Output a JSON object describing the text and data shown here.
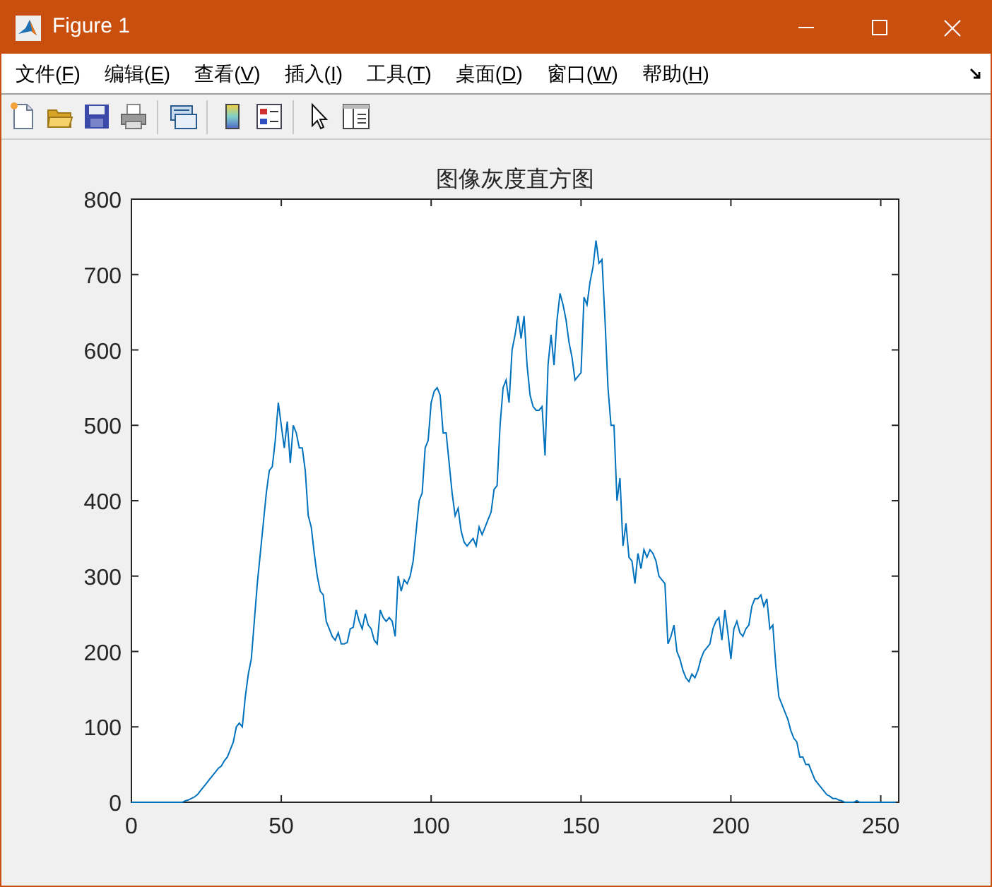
{
  "window": {
    "title": "Figure 1"
  },
  "menu": [
    {
      "label": "文件(",
      "mnemonic": "F",
      "tail": ")"
    },
    {
      "label": "编辑(",
      "mnemonic": "E",
      "tail": ")"
    },
    {
      "label": "查看(",
      "mnemonic": "V",
      "tail": ")"
    },
    {
      "label": "插入(",
      "mnemonic": "I",
      "tail": ")"
    },
    {
      "label": "工具(",
      "mnemonic": "T",
      "tail": ")"
    },
    {
      "label": "桌面(",
      "mnemonic": "D",
      "tail": ")"
    },
    {
      "label": "窗口(",
      "mnemonic": "W",
      "tail": ")"
    },
    {
      "label": "帮助(",
      "mnemonic": "H",
      "tail": ")"
    }
  ],
  "toolbar": [
    {
      "kind": "new"
    },
    {
      "kind": "open"
    },
    {
      "kind": "save"
    },
    {
      "kind": "print"
    },
    {
      "kind": "separator"
    },
    {
      "kind": "link"
    },
    {
      "kind": "separator"
    },
    {
      "kind": "colorbar"
    },
    {
      "kind": "legend"
    },
    {
      "kind": "separator"
    },
    {
      "kind": "pointer"
    },
    {
      "kind": "property"
    }
  ],
  "chart_data": {
    "type": "line",
    "title": "图像灰度直方图",
    "xlim": [
      0,
      256
    ],
    "ylim": [
      0,
      800
    ],
    "xticks": [
      0,
      50,
      100,
      150,
      200,
      250
    ],
    "yticks": [
      0,
      100,
      200,
      300,
      400,
      500,
      600,
      700,
      800
    ],
    "x": [
      0,
      1,
      2,
      3,
      4,
      5,
      6,
      7,
      8,
      9,
      10,
      11,
      12,
      13,
      14,
      15,
      16,
      17,
      18,
      19,
      20,
      21,
      22,
      23,
      24,
      25,
      26,
      27,
      28,
      29,
      30,
      31,
      32,
      33,
      34,
      35,
      36,
      37,
      38,
      39,
      40,
      41,
      42,
      43,
      44,
      45,
      46,
      47,
      48,
      49,
      50,
      51,
      52,
      53,
      54,
      55,
      56,
      57,
      58,
      59,
      60,
      61,
      62,
      63,
      64,
      65,
      66,
      67,
      68,
      69,
      70,
      71,
      72,
      73,
      74,
      75,
      76,
      77,
      78,
      79,
      80,
      81,
      82,
      83,
      84,
      85,
      86,
      87,
      88,
      89,
      90,
      91,
      92,
      93,
      94,
      95,
      96,
      97,
      98,
      99,
      100,
      101,
      102,
      103,
      104,
      105,
      106,
      107,
      108,
      109,
      110,
      111,
      112,
      113,
      114,
      115,
      116,
      117,
      118,
      119,
      120,
      121,
      122,
      123,
      124,
      125,
      126,
      127,
      128,
      129,
      130,
      131,
      132,
      133,
      134,
      135,
      136,
      137,
      138,
      139,
      140,
      141,
      142,
      143,
      144,
      145,
      146,
      147,
      148,
      149,
      150,
      151,
      152,
      153,
      154,
      155,
      156,
      157,
      158,
      159,
      160,
      161,
      162,
      163,
      164,
      165,
      166,
      167,
      168,
      169,
      170,
      171,
      172,
      173,
      174,
      175,
      176,
      177,
      178,
      179,
      180,
      181,
      182,
      183,
      184,
      185,
      186,
      187,
      188,
      189,
      190,
      191,
      192,
      193,
      194,
      195,
      196,
      197,
      198,
      199,
      200,
      201,
      202,
      203,
      204,
      205,
      206,
      207,
      208,
      209,
      210,
      211,
      212,
      213,
      214,
      215,
      216,
      217,
      218,
      219,
      220,
      221,
      222,
      223,
      224,
      225,
      226,
      227,
      228,
      229,
      230,
      231,
      232,
      233,
      234,
      235,
      236,
      237,
      238,
      239,
      240,
      241,
      242,
      243,
      244,
      245,
      246,
      247,
      248,
      249,
      250,
      251,
      252,
      253,
      254,
      255
    ],
    "series": [
      {
        "color": "#0072bd",
        "values": [
          0,
          0,
          0,
          0,
          0,
          0,
          0,
          0,
          0,
          0,
          0,
          0,
          0,
          0,
          0,
          0,
          0,
          0,
          2,
          3,
          5,
          7,
          10,
          15,
          20,
          25,
          30,
          35,
          40,
          45,
          48,
          55,
          60,
          70,
          80,
          100,
          105,
          100,
          140,
          170,
          190,
          240,
          290,
          330,
          370,
          410,
          440,
          445,
          480,
          530,
          500,
          470,
          505,
          450,
          500,
          490,
          470,
          470,
          440,
          380,
          365,
          330,
          300,
          280,
          275,
          240,
          230,
          220,
          215,
          225,
          210,
          210,
          212,
          230,
          232,
          255,
          240,
          230,
          250,
          235,
          230,
          215,
          210,
          255,
          245,
          240,
          245,
          240,
          220,
          300,
          280,
          295,
          290,
          300,
          320,
          360,
          400,
          410,
          470,
          480,
          530,
          545,
          550,
          540,
          490,
          490,
          450,
          410,
          380,
          390,
          360,
          345,
          340,
          345,
          350,
          340,
          365,
          355,
          365,
          375,
          385,
          415,
          420,
          500,
          550,
          560,
          530,
          600,
          620,
          645,
          615,
          645,
          580,
          540,
          525,
          520,
          520,
          525,
          460,
          580,
          620,
          580,
          640,
          675,
          660,
          640,
          610,
          590,
          560,
          565,
          570,
          670,
          660,
          690,
          710,
          745,
          715,
          720,
          640,
          550,
          500,
          500,
          400,
          430,
          340,
          370,
          325,
          320,
          290,
          330,
          310,
          335,
          325,
          335,
          330,
          320,
          300,
          295,
          290,
          210,
          220,
          235,
          200,
          190,
          175,
          165,
          160,
          170,
          165,
          175,
          190,
          200,
          205,
          210,
          230,
          240,
          245,
          215,
          255,
          225,
          190,
          230,
          240,
          225,
          220,
          230,
          235,
          260,
          270,
          270,
          275,
          260,
          270,
          230,
          235,
          180,
          140,
          130,
          120,
          110,
          95,
          85,
          80,
          60,
          60,
          50,
          50,
          40,
          30,
          25,
          20,
          15,
          10,
          8,
          5,
          5,
          3,
          2,
          0,
          0,
          0,
          0,
          2,
          0,
          0,
          0,
          0,
          0,
          0,
          0,
          0,
          0,
          0,
          0,
          0,
          0
        ]
      }
    ]
  }
}
